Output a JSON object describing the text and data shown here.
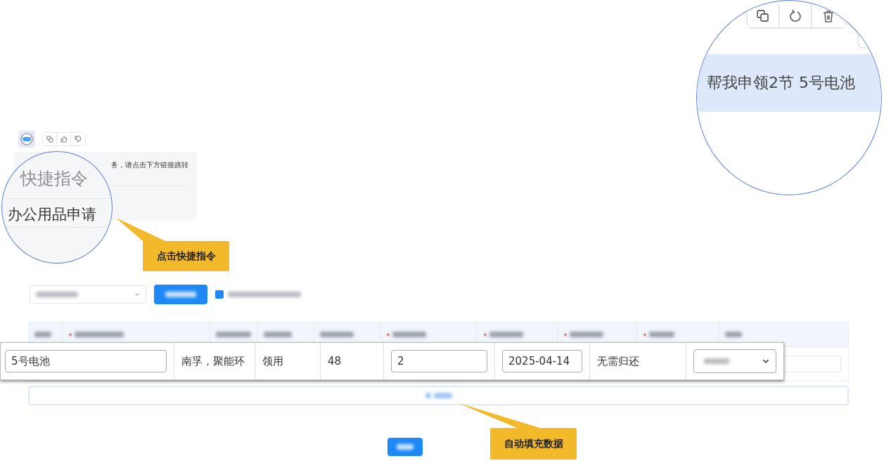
{
  "chat": {
    "message_fragment": "务，请点击下方链接跳转"
  },
  "magnifier_shortcuts": {
    "heading": "快捷指令",
    "link": "办公用品申请"
  },
  "magnifier_prompt": {
    "message": "帮我申领2节 5号电池"
  },
  "toolbar": {
    "notify_checked": true
  },
  "table": {
    "columns": [
      {
        "required": false
      },
      {
        "required": true
      },
      {
        "required": false
      },
      {
        "required": false
      },
      {
        "required": false
      },
      {
        "required": true
      },
      {
        "required": true
      },
      {
        "required": true
      },
      {
        "required": true
      },
      {
        "required": false
      }
    ],
    "row": {
      "item": "5号电池",
      "spec": "南孚，聚能环",
      "usage": "领用",
      "stock": "48",
      "quantity": "2",
      "date": "2025-04-14",
      "return_date": "无需归还"
    }
  },
  "callouts": [
    {
      "text": "点击快捷指令"
    },
    {
      "text": "自动填充数据"
    }
  ]
}
